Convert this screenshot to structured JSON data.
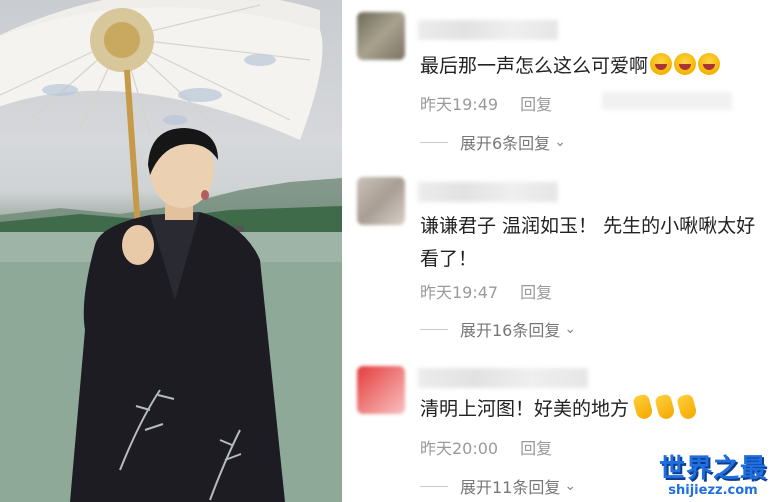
{
  "comments": [
    {
      "text": "最后那一声怎么这么可爱啊",
      "emoji_count": 3,
      "emoji_name": "laughing-emoji",
      "time": "昨天19:49",
      "reply_label": "回复",
      "expand_label": "展开6条回复",
      "avatar_color": "#8f8a7a"
    },
    {
      "text": "谦谦君子 温润如玉！ 先生的小啾啾太好看了！",
      "time": "昨天19:47",
      "reply_label": "回复",
      "expand_label": "展开16条回复",
      "avatar_color": "#b8b0a8"
    },
    {
      "text": "清明上河图！好美的地方",
      "emoji_count": 3,
      "emoji_name": "heart-hands-emoji",
      "time": "昨天20:00",
      "reply_label": "回复",
      "expand_label": "展开11条回复",
      "avatar_color": "#e23a3a"
    }
  ],
  "watermark": {
    "cn": "世界之最",
    "en": "shijiezz.com"
  }
}
